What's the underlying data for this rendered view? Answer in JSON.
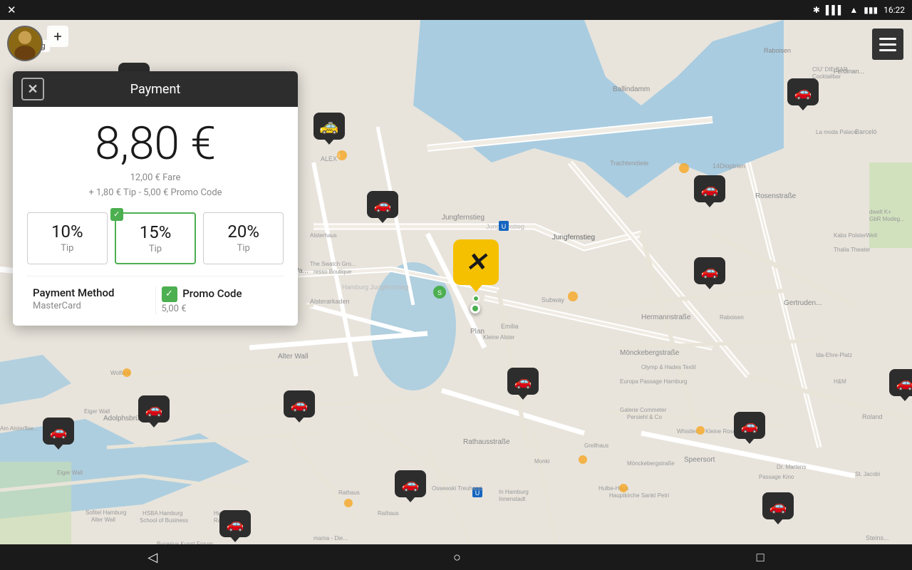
{
  "statusBar": {
    "appIcon": "✕",
    "bluetooth": "bluetooth",
    "signal": "signal",
    "wifi": "wifi",
    "battery": "battery",
    "time": "16:22"
  },
  "header": {
    "userLocation": "Hamburg",
    "hamburgerMenu": "menu"
  },
  "payment": {
    "title": "Payment",
    "closeLabel": "✕",
    "mainPrice": "8,80 €",
    "fareDetail1": "12,00 € Fare",
    "fareDetail2": "+ 1,80 € Tip - 5,00 € Promo Code",
    "tips": [
      {
        "pct": "10%",
        "label": "Tip",
        "selected": false
      },
      {
        "pct": "15%",
        "label": "Tip",
        "selected": true
      },
      {
        "pct": "20%",
        "label": "Tip",
        "selected": false
      }
    ],
    "paymentMethodLabel": "Payment Method",
    "paymentMethodValue": "MasterCard",
    "promoCodeLabel": "Promo Code",
    "promoCodeValue": "5,00 €"
  },
  "nav": {
    "back": "◁",
    "home": "○",
    "recent": "□"
  }
}
